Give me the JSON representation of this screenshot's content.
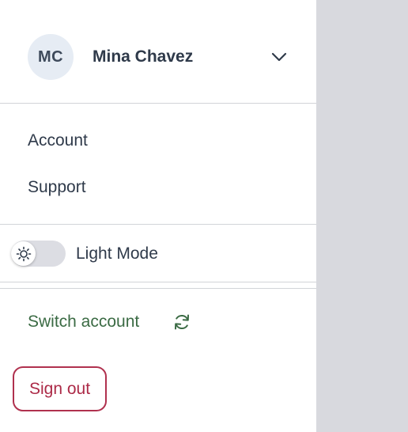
{
  "user": {
    "initials": "MC",
    "name": "Mina Chavez"
  },
  "menu": {
    "items": [
      {
        "label": "Account"
      },
      {
        "label": "Support"
      }
    ]
  },
  "theme": {
    "label": "Light Mode",
    "mode": "light",
    "icon": "sun-icon"
  },
  "actions": {
    "switch_account_label": "Switch account",
    "switch_account_icon": "refresh-icon",
    "sign_out_label": "Sign out"
  },
  "colors": {
    "switch_account": "#3b6b44",
    "sign_out": "#ac2a47",
    "avatar_bg": "#e6ecf4",
    "backdrop": "#d8d9de"
  }
}
